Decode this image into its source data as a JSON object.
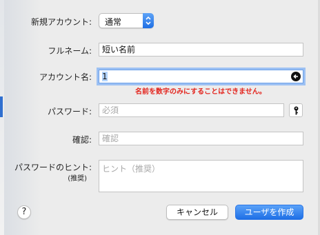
{
  "form": {
    "new_account": {
      "label": "新規アカウント:",
      "value": "通常"
    },
    "full_name": {
      "label": "フルネーム:",
      "value": "短い名前"
    },
    "account_name": {
      "label": "アカウント名:",
      "value": "1",
      "error": "名前を数字のみにすることはできません。"
    },
    "password": {
      "label": "パスワード:",
      "placeholder": "必須"
    },
    "verify": {
      "label": "確認:",
      "placeholder": "確認"
    },
    "hint": {
      "label": "パスワードのヒント:",
      "sublabel": "(推奨)",
      "placeholder": "ヒント（推奨）"
    }
  },
  "buttons": {
    "help": "?",
    "cancel": "キャンセル",
    "create": "ユーザを作成"
  },
  "icons": {
    "popup": "up-down-arrows-icon",
    "clear": "clear-circle-icon",
    "key": "key-icon"
  },
  "colors": {
    "accent": "#1e6fe6",
    "focus_ring": "#9dc1f3",
    "error": "#e3261f"
  }
}
